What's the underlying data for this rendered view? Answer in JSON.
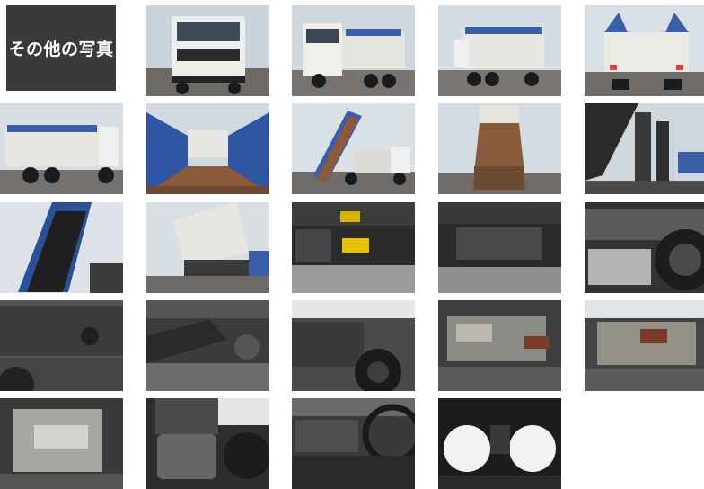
{
  "gallery": {
    "title": "その他の写真",
    "photos": [
      {
        "subject": "truck-front"
      },
      {
        "subject": "truck-front-quarter"
      },
      {
        "subject": "truck-rear-quarter"
      },
      {
        "subject": "truck-rear"
      },
      {
        "subject": "truck-side"
      },
      {
        "subject": "dump-bed-interior"
      },
      {
        "subject": "dump-bed-raised-side"
      },
      {
        "subject": "dump-bed-raised-rear"
      },
      {
        "subject": "hoist-mechanism"
      },
      {
        "subject": "raised-bed-closeup"
      },
      {
        "subject": "raised-bed-rear-corner"
      },
      {
        "subject": "chassis-frame-fuel-tank"
      },
      {
        "subject": "chassis-frame-underside"
      },
      {
        "subject": "chassis-frame-spare-tire"
      },
      {
        "subject": "fuel-tank-closeup"
      },
      {
        "subject": "frame-rail-components"
      },
      {
        "subject": "frame-and-rear-tire"
      },
      {
        "subject": "engine-top"
      },
      {
        "subject": "engine-side"
      },
      {
        "subject": "engine-compartment"
      },
      {
        "subject": "driver-seat"
      },
      {
        "subject": "dashboard-steering-wheel"
      },
      {
        "subject": "instrument-cluster"
      }
    ]
  }
}
